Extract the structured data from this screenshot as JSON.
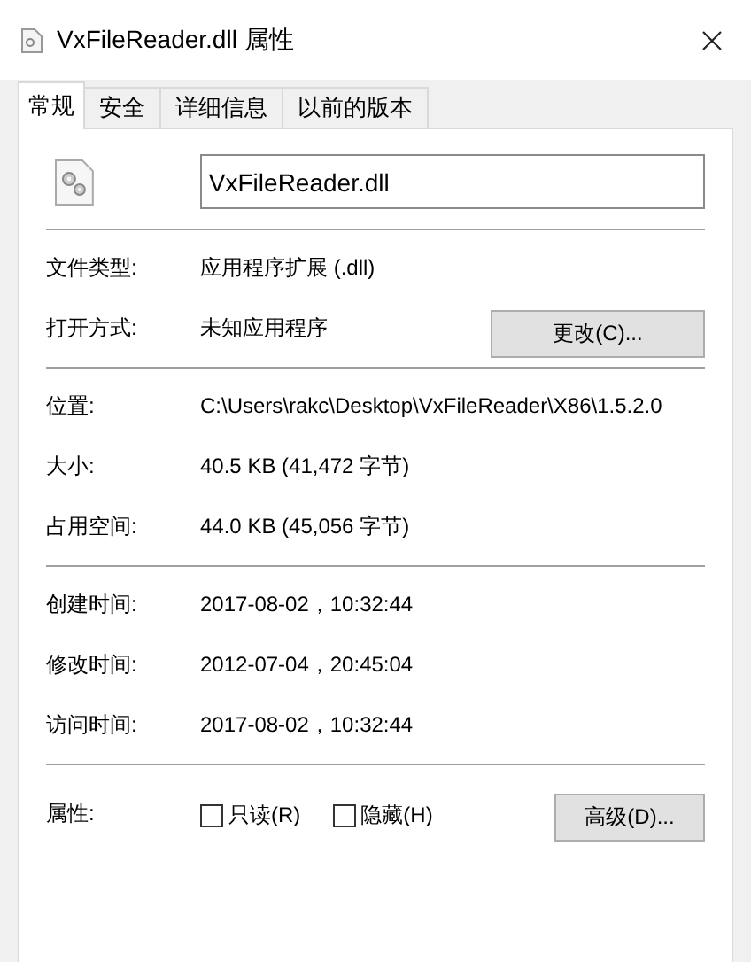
{
  "window": {
    "title": "VxFileReader.dll 属性"
  },
  "tabs": [
    {
      "label": "常规",
      "selected": true
    },
    {
      "label": "安全",
      "selected": false
    },
    {
      "label": "详细信息",
      "selected": false
    },
    {
      "label": "以前的版本",
      "selected": false
    }
  ],
  "file_name": {
    "value": "VxFileReader.dll"
  },
  "sections": [
    [
      {
        "label": "文件类型:",
        "value": "应用程序扩展 (.dll)"
      },
      {
        "label": "打开方式:",
        "value": "未知应用程序",
        "button": "更改(C)..."
      }
    ],
    [
      {
        "label": "位置:",
        "value": "C:\\Users\\rakc\\Desktop\\VxFileReader\\X86\\1.5.2.0"
      },
      {
        "label": "大小:",
        "value": "40.5 KB (41,472 字节)"
      },
      {
        "label": "占用空间:",
        "value": "44.0 KB (45,056 字节)"
      }
    ],
    [
      {
        "label": "创建时间:",
        "value": "2017-08-02，10:32:44"
      },
      {
        "label": "修改时间:",
        "value": "2012-07-04，20:45:04"
      },
      {
        "label": "访问时间:",
        "value": "2017-08-02，10:32:44"
      }
    ]
  ],
  "attributes": {
    "label": "属性:",
    "checkboxes": [
      {
        "label": "只读(R)",
        "checked": false
      },
      {
        "label": "隐藏(H)",
        "checked": false
      }
    ],
    "button": "高级(D)..."
  }
}
